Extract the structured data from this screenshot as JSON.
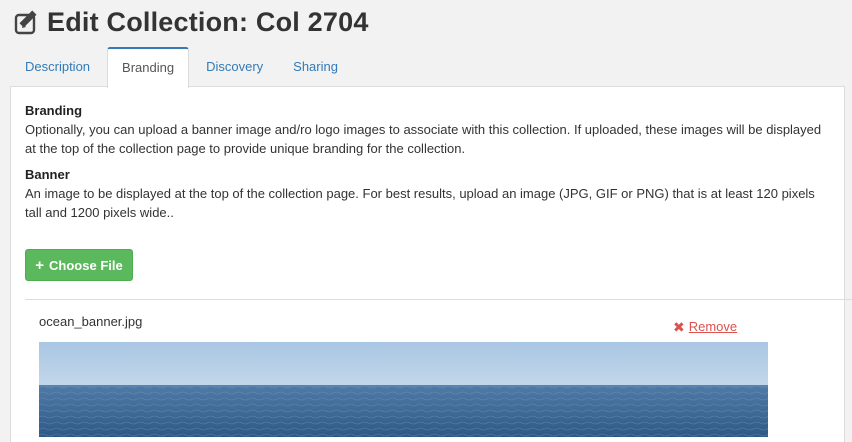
{
  "header": {
    "title": "Edit Collection: Col 2704",
    "icon": "edit-icon"
  },
  "tabs": [
    {
      "label": "Description",
      "active": false
    },
    {
      "label": "Branding",
      "active": true
    },
    {
      "label": "Discovery",
      "active": false
    },
    {
      "label": "Sharing",
      "active": false
    }
  ],
  "branding": {
    "heading": "Branding",
    "description": "Optionally, you can upload a banner image and/ro logo images to associate with this collection. If uploaded, these images will be displayed at the top of the collection page to provide unique branding for the collection."
  },
  "banner": {
    "heading": "Banner",
    "description": "An image to be displayed at the top of the collection page. For best results, upload an image (JPG, GIF or PNG) that is at least 120 pixels tall and 1200 pixels wide..",
    "choose_label": "Choose File",
    "choose_icon": "plus-icon",
    "file": {
      "name": "ocean_banner.jpg",
      "remove_label": "Remove",
      "remove_icon": "times-icon"
    }
  },
  "colors": {
    "link": "#337ab7",
    "success": "#5cb85c",
    "danger": "#d9534f"
  }
}
